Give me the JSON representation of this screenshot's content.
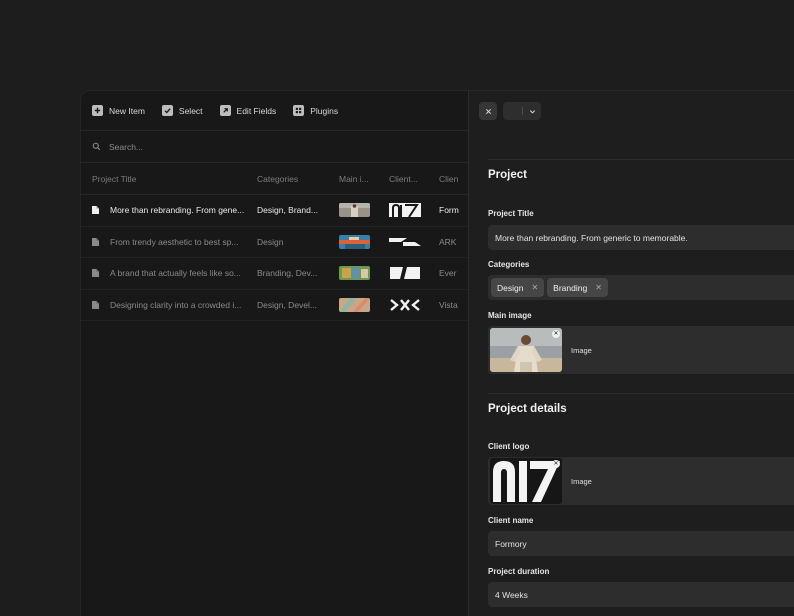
{
  "toolbar": {
    "new_item": "New Item",
    "select": "Select",
    "edit_fields": "Edit Fields",
    "plugins": "Plugins"
  },
  "search": {
    "placeholder": "Search..."
  },
  "table": {
    "headers": [
      "Project Title",
      "Categories",
      "Main i...",
      "Client...",
      "Clien"
    ],
    "rows": [
      {
        "title": "More than rebranding. From gene...",
        "categories": "Design, Brand...",
        "client": "Form"
      },
      {
        "title": "From trendy aesthetic to best sp...",
        "categories": "Design",
        "client": "ARK"
      },
      {
        "title": "A brand that actually feels like so...",
        "categories": "Branding, Dev...",
        "client": "Ever"
      },
      {
        "title": "Designing clarity into a crowded i...",
        "categories": "Design, Devel...",
        "client": "Vista"
      }
    ]
  },
  "panel": {
    "section1": "Project",
    "title_label": "Project Title",
    "title_value": "More than rebranding. From generic to memorable.",
    "categories_label": "Categories",
    "categories": [
      "Design",
      "Branding"
    ],
    "main_image_label": "Main image",
    "main_image_text": "Image",
    "section2": "Project details",
    "client_logo_label": "Client logo",
    "client_logo_text": "Image",
    "client_name_label": "Client name",
    "client_name_value": "Formory",
    "duration_label": "Project duration",
    "duration_value": "4 Weeks"
  },
  "icons": {
    "new_item": "plus-icon",
    "select": "checkbox-icon",
    "edit_fields": "arrow-up-right-icon",
    "plugins": "grid-icon",
    "search": "search-icon",
    "row": "document-icon",
    "close": "close-icon",
    "nav": "chevron-down-icon",
    "remove": "remove-icon"
  },
  "colors": {
    "background": "#1d1d1d",
    "panel": "#1e1e1e",
    "field": "#2d2d2d",
    "tag": "#464646",
    "text": "#e8e8e8",
    "muted": "#8a8a8a"
  }
}
